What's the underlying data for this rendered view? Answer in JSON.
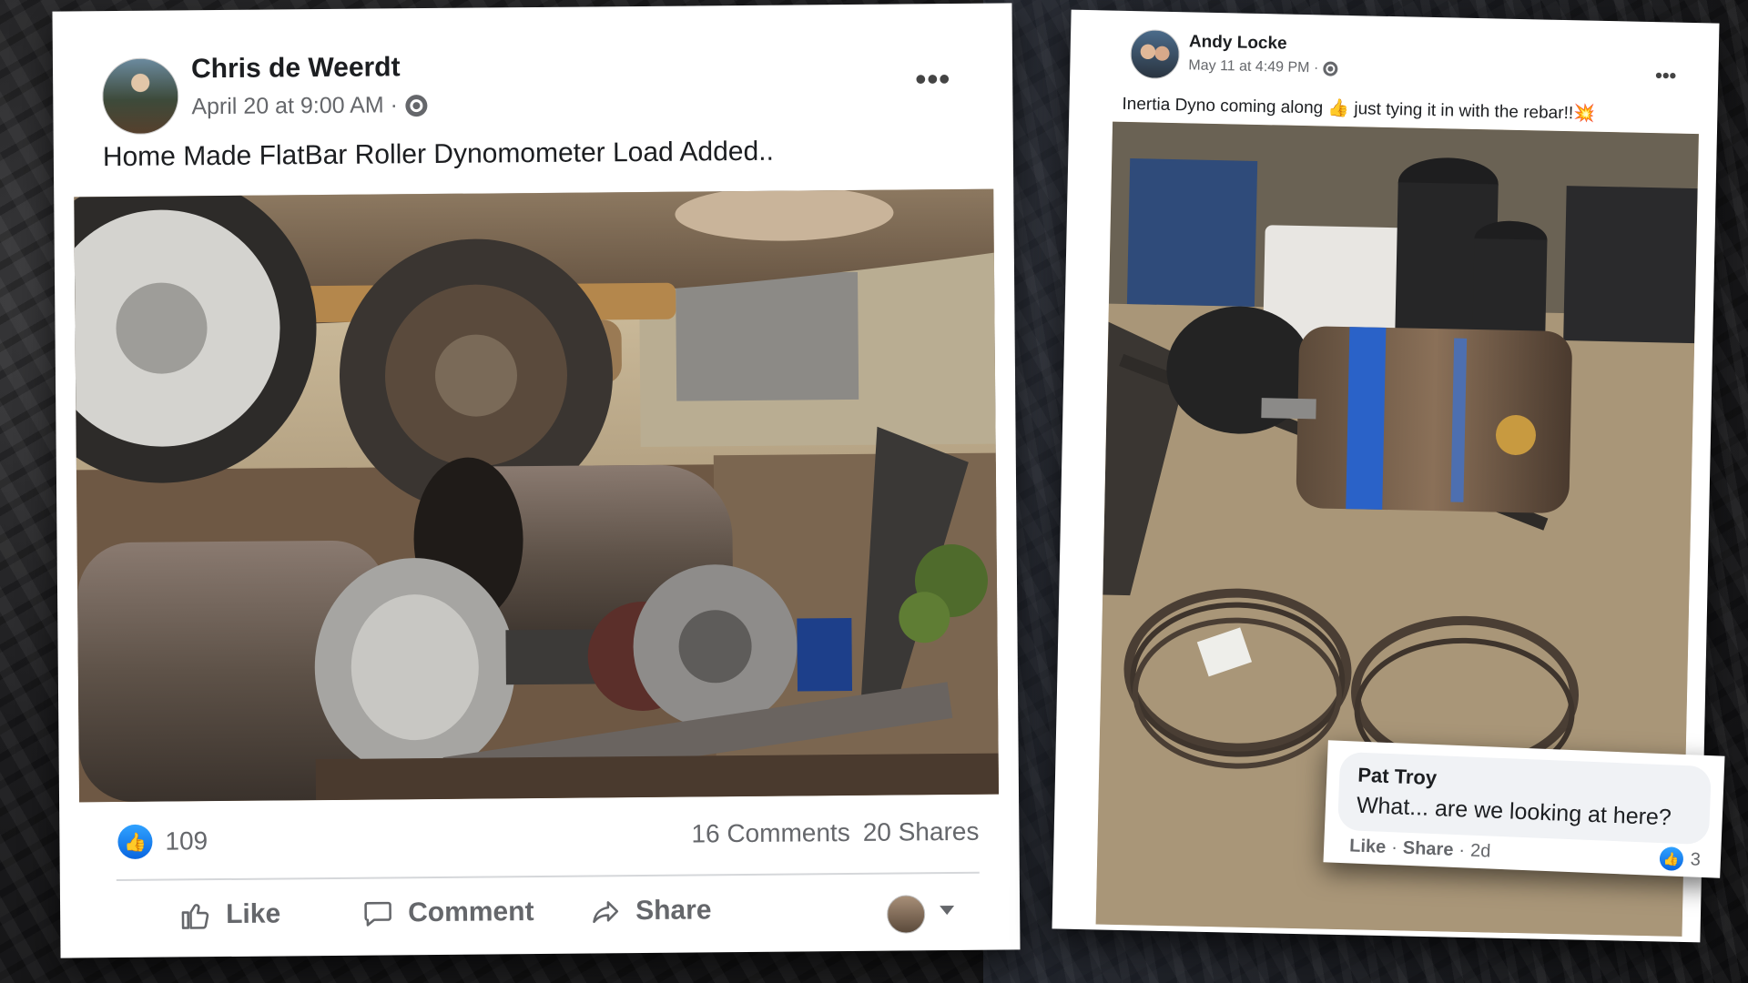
{
  "left_post": {
    "author": "Chris de Weerdt",
    "date": "April 20 at 9:00 AM ·",
    "more_icon": "•••",
    "text": "Home Made FlatBar Roller Dynomometer Load Added..",
    "likes": "109",
    "comments": "16 Comments",
    "shares": "20 Shares",
    "actions": {
      "like": "Like",
      "comment": "Comment",
      "share": "Share"
    },
    "like_badge_icon": "👍",
    "accent": "#1877f2"
  },
  "right_post": {
    "author": "Andy Locke",
    "date": "May 11 at 4:49 PM ·",
    "more_icon": "•••",
    "text": "Inertia Dyno coming along 👍 just tying it in with the rebar!!💥"
  },
  "comment": {
    "author": "Pat Troy",
    "text": "What... are we looking at here?",
    "like": "Like",
    "share": "Share",
    "time": "2d",
    "sep": "·",
    "reactions": "3",
    "like_badge_icon": "👍"
  }
}
